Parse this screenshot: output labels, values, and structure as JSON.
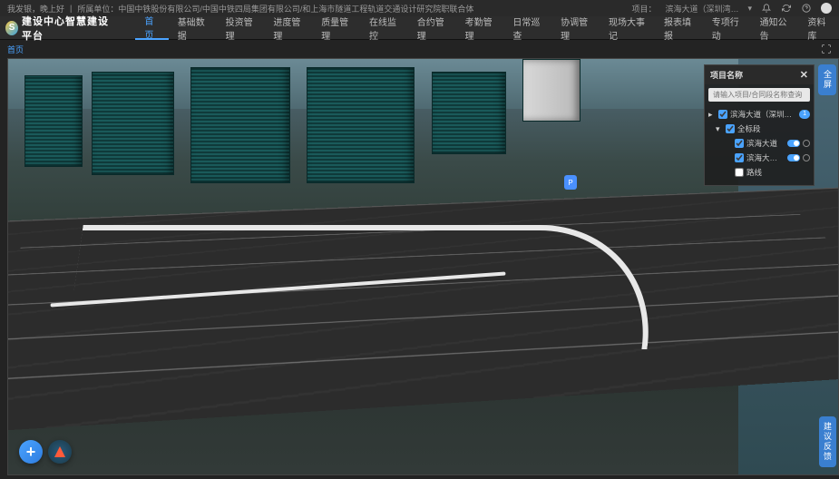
{
  "info_bar": {
    "user_icon_label": "用户",
    "greeting": "我发银，晚上好",
    "divider": "|",
    "org": "所属单位：中国中铁股份有限公司/中国中铁四局集团有限公司/和上海市隧道工程轨道交通设计研究院职联合体",
    "project_label": "项目：",
    "project_name": "滨海大道（深圳湾…",
    "dropdown_icon": "▾"
  },
  "header": {
    "app_title": "建设中心智慧建设平台",
    "nav": [
      "首页",
      "基础数据",
      "投资管理",
      "进度管理",
      "质量管理",
      "在线监控",
      "合约管理",
      "考勤管理",
      "日常巡查",
      "协调管理",
      "现场大事记",
      "报表填报",
      "专项行动",
      "通知公告",
      "资料库"
    ],
    "active_index": 0
  },
  "breadcrumb": {
    "home": "首页"
  },
  "panel": {
    "title": "项目名称",
    "close_glyph": "✕",
    "search_placeholder": "请输入项目/合同段名称查询",
    "tree": [
      {
        "level": 0,
        "caret": "▸",
        "checked": true,
        "label": "滨海大道（深圳湾总部基地段…",
        "badge": "1",
        "toggle": false,
        "eye": false
      },
      {
        "level": 1,
        "caret": "▾",
        "checked": true,
        "label": "全标段",
        "toggle": false,
        "eye": false
      },
      {
        "level": 2,
        "caret": "",
        "checked": true,
        "label": "滨海大道",
        "toggle": true,
        "eye": true
      },
      {
        "level": 2,
        "caret": "",
        "checked": true,
        "label": "滨海大道倾斜…",
        "toggle": true,
        "eye": true
      },
      {
        "level": 2,
        "caret": "",
        "checked": false,
        "label": "路线",
        "toggle": false,
        "eye": false
      }
    ]
  },
  "edge_tabs": {
    "top": "全屏",
    "bottom": "建议反馈"
  },
  "fab": {
    "add_glyph": "+"
  },
  "marker": {
    "glyph": "P"
  }
}
